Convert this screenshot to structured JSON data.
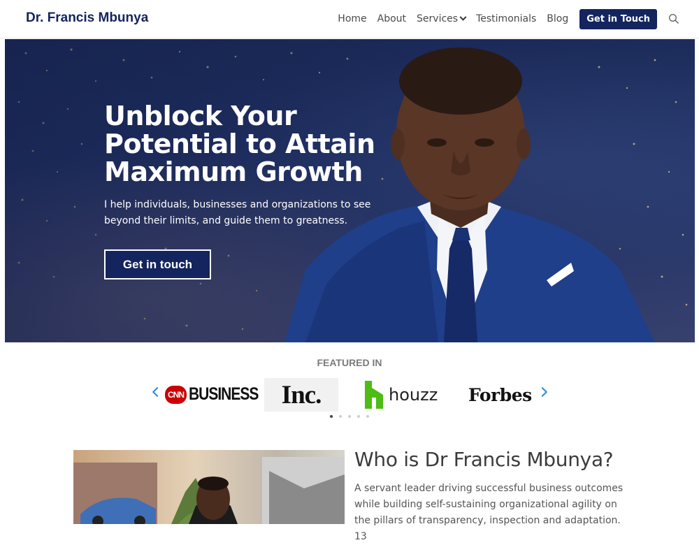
{
  "header": {
    "brand": "Dr. Francis Mbunya",
    "nav": [
      {
        "label": "Home"
      },
      {
        "label": "About"
      },
      {
        "label": "Services"
      },
      {
        "label": "Testimonials"
      },
      {
        "label": "Blog"
      }
    ],
    "cta": "Get in Touch",
    "search_icon": "search-icon",
    "brand_color": "#14245e"
  },
  "hero": {
    "title": "Unblock Your Potential to Attain Maximum Growth",
    "subtitle": "I help individuals, businesses and organizations to see beyond their limits, and guide them to greatness.",
    "button": "Get in touch"
  },
  "featured": {
    "label": "FEATURED IN",
    "logos": [
      "CNN BUSINESS",
      "Inc.",
      "houzz",
      "Forbes"
    ],
    "active_slide": 1,
    "slide_count": 5
  },
  "about": {
    "title": "Who is Dr Francis Mbunya?",
    "text": "A servant leader driving successful business outcomes while building self-sustaining organizational agility on the pillars of transparency, inspection and adaptation. 13"
  }
}
